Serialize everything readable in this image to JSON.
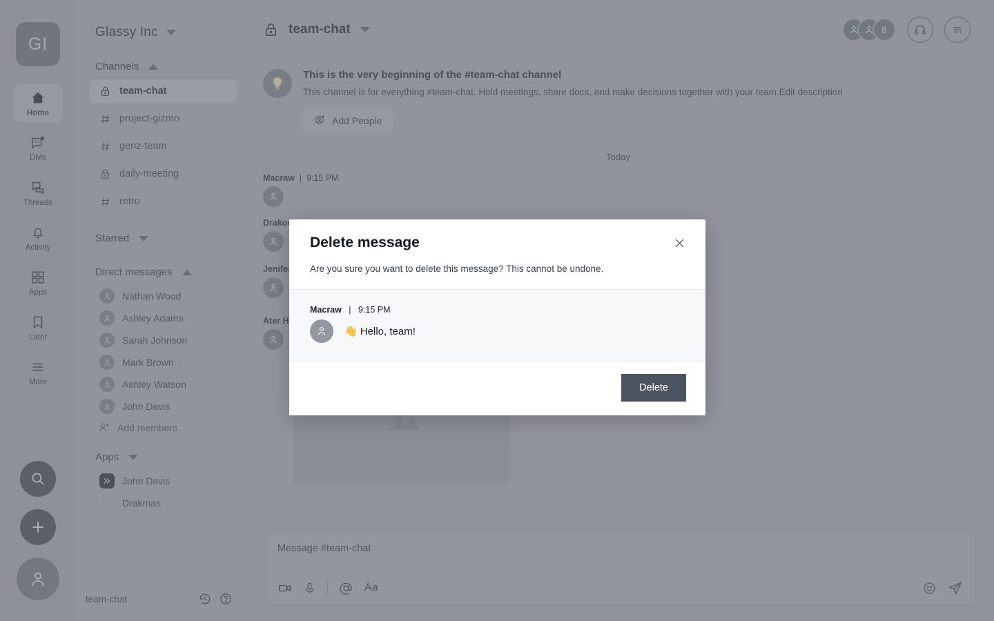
{
  "workspace": {
    "initials": "GI",
    "name": "Glassy Inc"
  },
  "rail": {
    "items": [
      {
        "label": "Home",
        "icon": "home-icon",
        "active": true
      },
      {
        "label": "DMs",
        "icon": "dms-icon",
        "active": false
      },
      {
        "label": "Threads",
        "icon": "threads-icon",
        "active": false
      },
      {
        "label": "Activity",
        "icon": "bell-icon",
        "active": false
      },
      {
        "label": "Apps",
        "icon": "apps-grid-icon",
        "active": false
      },
      {
        "label": "Later",
        "icon": "bookmark-icon",
        "active": false
      },
      {
        "label": "More",
        "icon": "more-hamburger-icon",
        "active": false
      }
    ],
    "search_icon": "search-icon",
    "compose_icon": "plus-icon",
    "profile_icon": "user-avatar-icon"
  },
  "sidebar": {
    "channels_section": {
      "title": "Channels",
      "collapsed": false
    },
    "channels": [
      {
        "name": "team-chat",
        "icon": "lock-icon",
        "active": true
      },
      {
        "name": "project-gizmo",
        "icon": "hash-icon",
        "active": false
      },
      {
        "name": "genz-team",
        "icon": "hash-icon",
        "active": false
      },
      {
        "name": "daily-meeting",
        "icon": "lock-icon",
        "active": false
      },
      {
        "name": "retro",
        "icon": "hash-icon",
        "active": false
      }
    ],
    "starred_section": {
      "title": "Starred",
      "collapsed": true
    },
    "dm_section": {
      "title": "Direct messages",
      "collapsed": false
    },
    "dms": [
      {
        "name": "Nathan Wood"
      },
      {
        "name": "Ashley Adams"
      },
      {
        "name": "Sarah Johnson"
      },
      {
        "name": "Mark Brown"
      },
      {
        "name": "Ashley Watson"
      },
      {
        "name": "John Davis"
      }
    ],
    "add_members_label": "Add members",
    "apps_section": {
      "title": "Apps",
      "collapsed": true
    },
    "apps": [
      {
        "name": "John Davis",
        "icon": "chevrons-app-icon"
      },
      {
        "name": "Drakmas",
        "icon": "drakmas-app-icon"
      }
    ],
    "footer": {
      "channel_name": "team-chat",
      "history_icon": "history-clock-icon",
      "help_icon": "help-question-icon"
    }
  },
  "header": {
    "channel_icon": "lock-icon",
    "channel_name": "team-chat",
    "member_count": "8",
    "huddle_icon": "headphones-icon",
    "details_icon": "list-details-icon"
  },
  "channel_intro": {
    "title": "This is the very beginning of the #team-chat  channel",
    "description": "This channel is for everything #team-chat. Hold meetings, share docs, and make decisions together with your team.Edit description",
    "add_people_label": "Add People",
    "bulb_icon": "lightbulb-icon"
  },
  "conversation": {
    "day_divider": "Today",
    "messages": [
      {
        "author": "Macraw",
        "time": "9:15 PM",
        "text": "",
        "has_image": false
      },
      {
        "author": "Drakod",
        "time": "",
        "text": "",
        "has_image": false
      },
      {
        "author": "Jenifer",
        "time": "",
        "text": "",
        "has_image": false
      },
      {
        "author": "Ater Henry",
        "time": "",
        "text": "",
        "has_image": true
      }
    ]
  },
  "composer": {
    "placeholder": "Message #team-chat",
    "tools": [
      {
        "name": "video-icon"
      },
      {
        "name": "microphone-icon"
      },
      {
        "name": "mention-at-icon"
      },
      {
        "name": "text-format-icon"
      }
    ],
    "right_tools": [
      {
        "name": "emoji-icon"
      },
      {
        "name": "send-icon"
      }
    ]
  },
  "modal": {
    "title": "Delete message",
    "subtitle": "Are you sure you want to delete this message? This cannot be undone.",
    "close_icon": "close-icon",
    "preview": {
      "author": "Macraw",
      "separator": "|",
      "time": "9:15 PM",
      "text": "👋 Hello, team!"
    },
    "delete_label": "Delete"
  },
  "colors": {
    "backdrop": "#a4a7ad",
    "sidebar": "#aaadb3",
    "delete_button": "#4d5361",
    "modal_bg": "#ffffff",
    "preview_bg": "#f7f8f9"
  }
}
